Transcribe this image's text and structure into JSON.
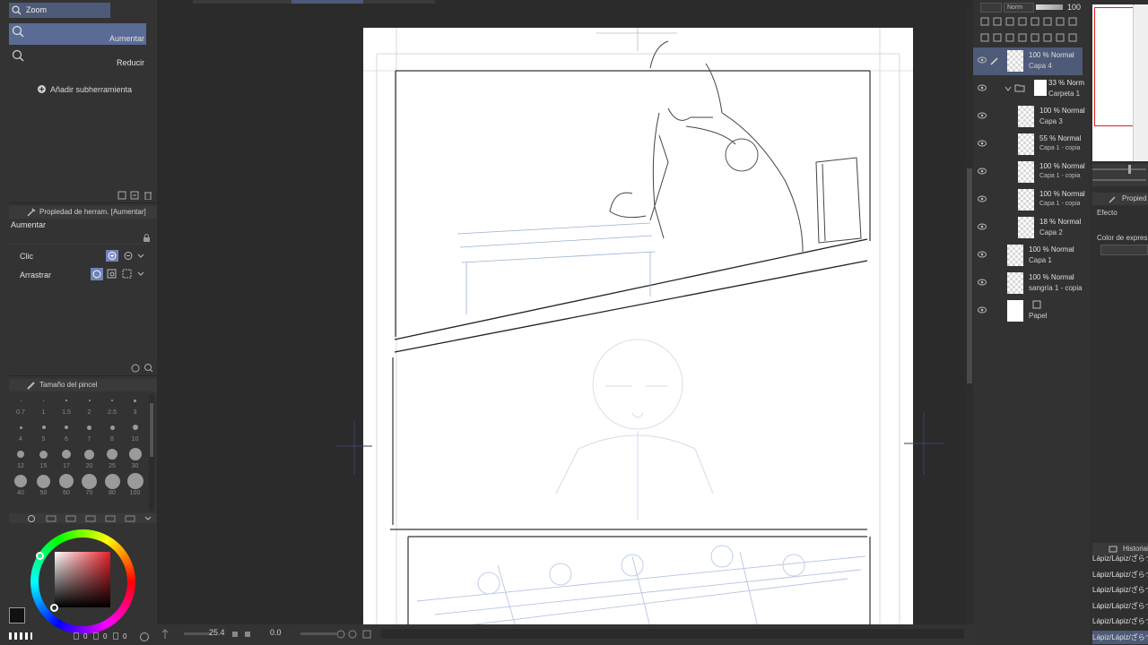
{
  "tool_panel": {
    "zoom_label": "Zoom",
    "aumentar_label": "Aumentar",
    "reducir_label": "Reducir",
    "add_subtool_label": "Añadir subherramienta"
  },
  "tool_property": {
    "header": "Propiedad de herram. [Aumentar]",
    "tool_name": "Aumentar",
    "clic_label": "Clic",
    "arrastrar_label": "Arrastrar"
  },
  "brush_size": {
    "header": "Tamaño del pincel",
    "sizes": [
      "0.7",
      "1",
      "1.5",
      "2",
      "2.5",
      "3",
      "4",
      "5",
      "6",
      "7",
      "8",
      "10",
      "12",
      "15",
      "17",
      "20",
      "25",
      "30",
      "40",
      "50",
      "60",
      "70",
      "80",
      "100"
    ]
  },
  "color": {
    "main": "#111111",
    "hue_accent": "#e8202a",
    "values": [
      "0",
      "0",
      "0"
    ]
  },
  "canvas": {
    "zoom_value": "25.4",
    "rotation_value": "0.0"
  },
  "layer_panel": {
    "blend_mode": "Norm",
    "opacity_value": "100",
    "layers": [
      {
        "opacity": "100 % Normal",
        "name": "Capa 4",
        "selected": true
      },
      {
        "opacity": "33 % Norm",
        "name": "Carpeta 1",
        "folder": true
      },
      {
        "opacity": "100 % Normal",
        "name": "Capa 3"
      },
      {
        "opacity": "55 % Normal",
        "name": "Capa 1 - copia"
      },
      {
        "opacity": "100 % Normal",
        "name": "Capa 1 - copia"
      },
      {
        "opacity": "100 % Normal",
        "name": "Capa 1 - copia"
      },
      {
        "opacity": "18 % Normal",
        "name": "Capa 2"
      },
      {
        "opacity": "100 % Normal",
        "name": "Capa 1"
      },
      {
        "opacity": "100 % Normal",
        "name": "sangría 1 - copia"
      },
      {
        "opacity": "",
        "name": "Papel"
      }
    ]
  },
  "right_panel": {
    "properties_header": "Propied",
    "efecto_label": "Efecto",
    "color_expr_label": "Color de expresi",
    "history_header": "Historial",
    "history_items": [
      "Lápiz/Lápiz/ざらつ",
      "Lápiz/Lápiz/ざらつ",
      "Lápiz/Lápiz/ざらつ",
      "Lápiz/Lápiz/ざらつ",
      "Lápiz/Lápiz/ざらつ",
      "Lápiz/Lápiz/ざらつ"
    ]
  }
}
